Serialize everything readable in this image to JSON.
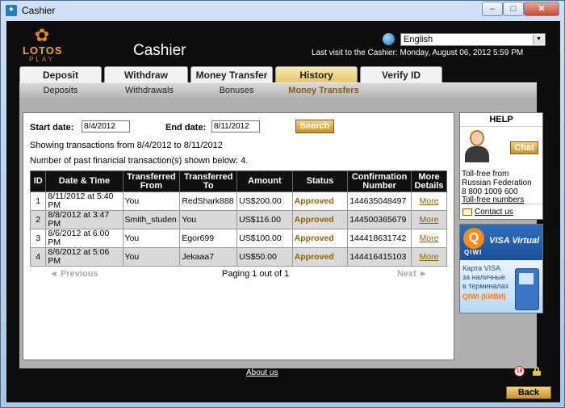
{
  "window": {
    "title": "Cashier",
    "min_glyph": "–",
    "max_glyph": "□",
    "close_glyph": "✕"
  },
  "logo": {
    "line1": "LOTOS",
    "line2": "PLAY"
  },
  "header": {
    "title": "Cashier",
    "language": "English",
    "last_visit": "Last visit to the Cashier: Monday, August 06, 2012 5:59 PM"
  },
  "tabs": [
    {
      "label": "Deposit"
    },
    {
      "label": "Withdraw"
    },
    {
      "label": "Money Transfer"
    },
    {
      "label": "History",
      "active": true
    },
    {
      "label": "Verify ID"
    }
  ],
  "subtabs": [
    {
      "label": "Deposits"
    },
    {
      "label": "Withdrawals"
    },
    {
      "label": "Bonuses"
    },
    {
      "label": "Money Transfers",
      "active": true
    }
  ],
  "filter": {
    "start_label": "Start date:",
    "start_value": "8/4/2012",
    "end_label": "End date:",
    "end_value": "8/11/2012",
    "search_label": "Search"
  },
  "info": {
    "showing": "Showing transactions from 8/4/2012 to 8/11/2012",
    "count": "Number of past financial transaction(s) shown below: 4."
  },
  "table": {
    "headers": [
      "ID",
      "Date & Time",
      "Transferred From",
      "Transferred To",
      "Amount",
      "Status",
      "Confirmation Number",
      "More Details"
    ],
    "rows": [
      {
        "id": "1",
        "date": "8/11/2012 at 5:40 PM",
        "from": "You",
        "to": "RedShark888",
        "amount": "US$200.00",
        "status": "Approved",
        "conf": "144635048497",
        "more": "More"
      },
      {
        "id": "2",
        "date": "8/8/2012 at 3:47 PM",
        "from": "Smith_studen",
        "to": "You",
        "amount": "US$116.00",
        "status": "Approved",
        "conf": "144500365679",
        "more": "More"
      },
      {
        "id": "3",
        "date": "8/6/2012 at 6:00 PM",
        "from": "You",
        "to": "Egor699",
        "amount": "US$100.00",
        "status": "Approved",
        "conf": "144418631742",
        "more": "More"
      },
      {
        "id": "4",
        "date": "8/6/2012 at 5:06 PM",
        "from": "You",
        "to": "Jekaaa7",
        "amount": "US$50.00",
        "status": "Approved",
        "conf": "144416415103",
        "more": "More"
      }
    ]
  },
  "pager": {
    "prev": "◄ Previous",
    "info": "Paging 1 out of 1",
    "next": "Next ►"
  },
  "help": {
    "title": "HELP",
    "chat": "Chat",
    "tollfree_1": "Toll-free from",
    "tollfree_2": "Russian Federation",
    "phone": "8 800 1009 600",
    "tollfree_link": "Toll-free numbers",
    "contact": "Contact us"
  },
  "qiwi": {
    "logo": "Q",
    "name": "QIWI",
    "visa": "VISA Virtual",
    "line1": "Карта VISA",
    "line2": "за наличные",
    "line3": "в терминалах",
    "line4": "QIWI (КИВИ)"
  },
  "footer": {
    "about": "About us",
    "age": "18",
    "back": "Back"
  },
  "colors": {
    "accent": "#c9922a",
    "status": "#8a6400",
    "background": "#0d0d0d"
  }
}
